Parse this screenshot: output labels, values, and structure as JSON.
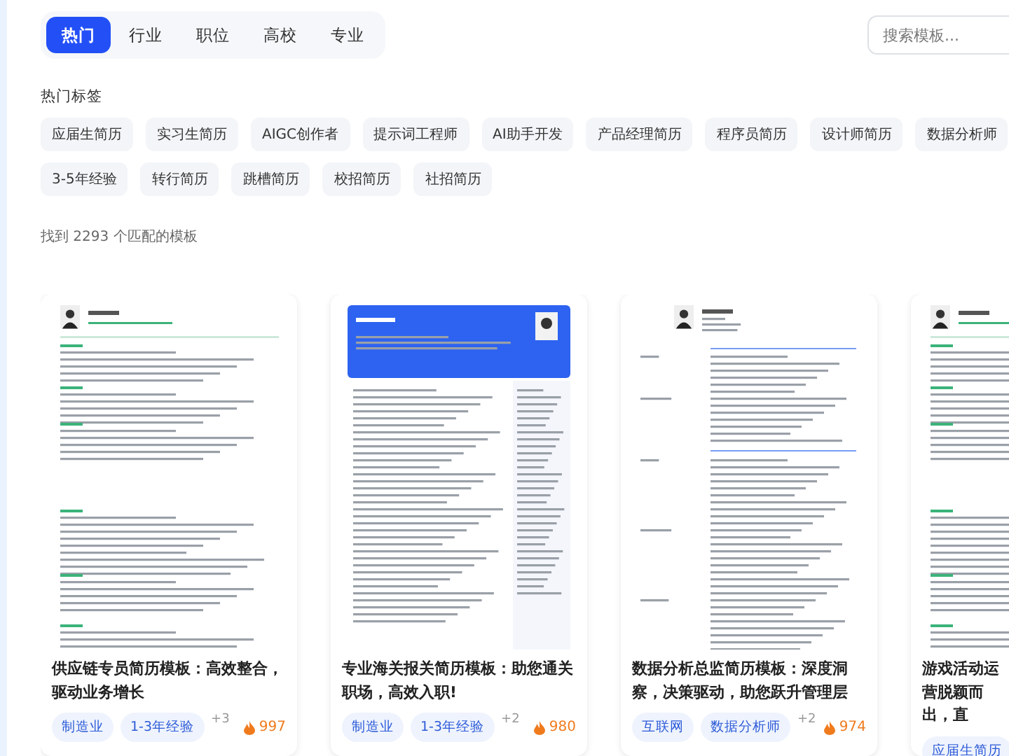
{
  "tabs": [
    {
      "label": "热门",
      "selected": true
    },
    {
      "label": "行业",
      "selected": false
    },
    {
      "label": "职位",
      "selected": false
    },
    {
      "label": "高校",
      "selected": false
    },
    {
      "label": "专业",
      "selected": false
    }
  ],
  "search": {
    "placeholder": "搜索模板..."
  },
  "hot_tags": {
    "title": "热门标签",
    "tags": [
      "应届生简历",
      "实习生简历",
      "AIGC创作者",
      "提示词工程师",
      "AI助手开发",
      "产品经理简历",
      "程序员简历",
      "设计师简历",
      "数据分析师",
      "3-5年经验",
      "转行简历",
      "跳槽简历",
      "校招简历",
      "社招简历"
    ]
  },
  "result_count": "找到 2293 个匹配的模板",
  "cards": [
    {
      "kind": "classic",
      "title": "供应链专员简历模板：高效整合，驱动业务增长",
      "tags": [
        "制造业",
        "1-3年经验"
      ],
      "more": "+3",
      "hot": "997"
    },
    {
      "kind": "blue_header",
      "title": "专业海关报关简历模板：助您通关职场，高效入职!",
      "tags": [
        "制造业",
        "1-3年经验"
      ],
      "more": "+2",
      "hot": "980"
    },
    {
      "kind": "timeline",
      "title": "数据分析总监简历模板：深度洞察，决策驱动，助您跃升管理层",
      "tags": [
        "互联网",
        "数据分析师"
      ],
      "more": "+2",
      "hot": "974"
    },
    {
      "kind": "classic",
      "title": "游戏活动运营脱颖而出，直",
      "tags": [
        "应届生简历"
      ]
    }
  ]
}
